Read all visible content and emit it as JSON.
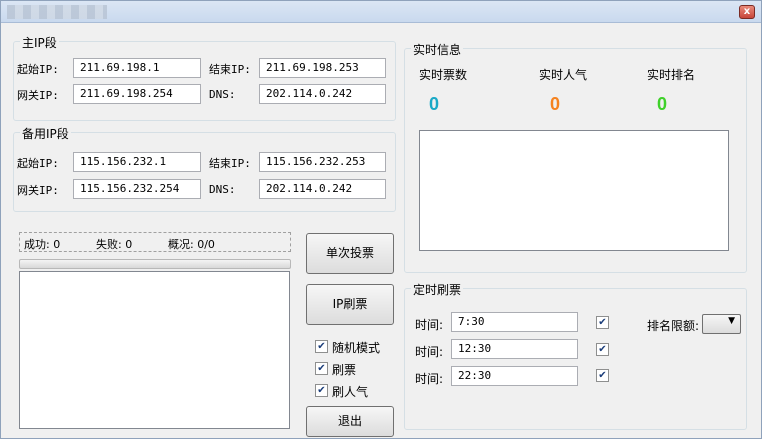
{
  "window": {
    "close_glyph": "x"
  },
  "primary": {
    "title": "主IP段",
    "start_label": "起始IP:",
    "start_value": "211.69.198.1",
    "end_label": "结束IP:",
    "end_value": "211.69.198.253",
    "gateway_label": "网关IP:",
    "gateway_value": "211.69.198.254",
    "dns_label": "DNS:",
    "dns_value": "202.114.0.242"
  },
  "backup": {
    "title": "备用IP段",
    "start_label": "起始IP:",
    "start_value": "115.156.232.1",
    "end_label": "结束IP:",
    "end_value": "115.156.232.253",
    "gateway_label": "网关IP:",
    "gateway_value": "115.156.232.254",
    "dns_label": "DNS:",
    "dns_value": "202.114.0.242"
  },
  "status": {
    "success": "成功: 0",
    "fail": "失败: 0",
    "overview": "概况: 0/0"
  },
  "buttons": {
    "single_vote": "单次投票",
    "ip_refresh": "IP刷票",
    "exit": "退出"
  },
  "options": [
    {
      "label": "随机模式",
      "checked": true
    },
    {
      "label": "刷票",
      "checked": true
    },
    {
      "label": "刷人气",
      "checked": true
    }
  ],
  "realtime": {
    "title": "实时信息",
    "votes_label": "实时票数",
    "votes_value": "0",
    "votes_color": "#1aa9c6",
    "popularity_label": "实时人气",
    "popularity_value": "0",
    "popularity_color": "#f5821f",
    "rank_label": "实时排名",
    "rank_value": "0",
    "rank_color": "#3fd12a"
  },
  "timed": {
    "title": "定时刷票",
    "time_label": "时间:",
    "times": [
      {
        "value": "7:30",
        "checked": true
      },
      {
        "value": "12:30",
        "checked": true
      },
      {
        "value": "22:30",
        "checked": true
      }
    ],
    "rank_limit_label": "排名限额:",
    "rank_limit_value": ""
  }
}
